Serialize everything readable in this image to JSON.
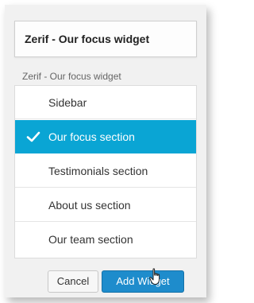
{
  "widget": {
    "title": "Zerif - Our focus widget",
    "subtitle": "Zerif - Our focus widget"
  },
  "dropdown": {
    "options": [
      {
        "label": "Sidebar",
        "selected": false
      },
      {
        "label": "Our focus section",
        "selected": true
      },
      {
        "label": "Testimonials section",
        "selected": false
      },
      {
        "label": "About us section",
        "selected": false
      },
      {
        "label": "Our team section",
        "selected": false
      }
    ],
    "selected_color": "#0aa5d4"
  },
  "buttons": {
    "cancel_label": "Cancel",
    "add_label": "Add Widget"
  },
  "colors": {
    "accent_button": "#1e8ccc",
    "panel_bg": "#f1f1f1"
  },
  "icons": {
    "check": "checkmark-icon",
    "cursor": "hand-pointer-icon"
  }
}
